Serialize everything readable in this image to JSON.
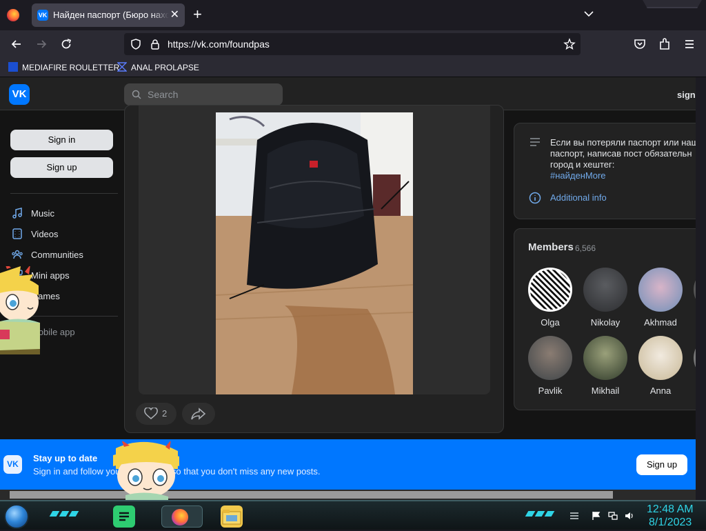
{
  "browser": {
    "tab_title": "Найден паспорт (Бюро находок)",
    "url": "https://vk.com/foundpas",
    "bookmarks": [
      {
        "label": "MEDIAFIRE ROULETTER"
      },
      {
        "label": "ANAL PROLAPSE"
      }
    ]
  },
  "vk": {
    "header": {
      "search_placeholder": "Search",
      "sign_in_top": "sign"
    },
    "sidebar": {
      "sign_in": "Sign in",
      "sign_up": "Sign up",
      "items": [
        {
          "label": "Music",
          "icon": "music-icon"
        },
        {
          "label": "Videos",
          "icon": "video-icon"
        },
        {
          "label": "Communities",
          "icon": "communities-icon"
        },
        {
          "label": "Mini apps",
          "icon": "mini-apps-icon"
        },
        {
          "label": "Games",
          "icon": "games-icon"
        },
        {
          "label": "Mobile app",
          "icon": "mobile-app-icon"
        }
      ]
    },
    "post": {
      "likes": "2"
    },
    "info": {
      "text": "Если вы потеряли паспорт или наш\nпаспорт, написав пост обязательн\nгород и хештег:",
      "hashtag": "#найденMore",
      "additional": "Additional info"
    },
    "members": {
      "title": "Members",
      "count": "6,566",
      "list": [
        {
          "name": "Olga"
        },
        {
          "name": "Nikolay"
        },
        {
          "name": "Akhmad"
        },
        {
          "name": "Pavlik"
        },
        {
          "name": "Mikhail"
        },
        {
          "name": "Anna"
        }
      ]
    },
    "banner": {
      "title": "Stay up to date",
      "subtitle": "Sign in and follow your community so that you don't miss any new posts.",
      "button": "Sign up"
    }
  },
  "taskbar": {
    "time": "12:48 AM",
    "date": "8/1/2023"
  },
  "colors": {
    "vk_blue": "#0077ff",
    "link_blue": "#71aaeb",
    "clock_cyan": "#2fd4e6"
  }
}
